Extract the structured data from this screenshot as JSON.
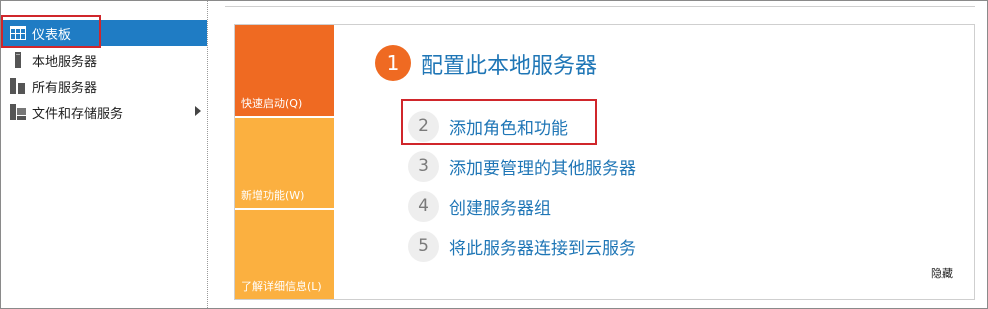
{
  "sidebar": {
    "items": [
      {
        "label": "仪表板",
        "icon": "dashboard-grid-icon",
        "selected": true
      },
      {
        "label": "本地服务器",
        "icon": "server-icon"
      },
      {
        "label": "所有服务器",
        "icon": "servers-icon"
      },
      {
        "label": "文件和存储服务",
        "icon": "file-storage-icon",
        "has_submenu": true
      }
    ]
  },
  "quick_tiles": [
    {
      "label": "快速启动(Q)",
      "color": "#ef6a22"
    },
    {
      "label": "新增功能(W)",
      "color": "#fbb040"
    },
    {
      "label": "了解详细信息(L)",
      "color": "#fbb040"
    }
  ],
  "steps": [
    {
      "number": "1",
      "label": "配置此本地服务器"
    },
    {
      "number": "2",
      "label": "添加角色和功能"
    },
    {
      "number": "3",
      "label": "添加要管理的其他服务器"
    },
    {
      "number": "4",
      "label": "创建服务器组"
    },
    {
      "number": "5",
      "label": "将此服务器连接到云服务"
    }
  ],
  "hide_label": "隐藏",
  "colors": {
    "accent": "#1f7cc4",
    "link": "#1f76b6",
    "orange": "#ef6a22",
    "amber": "#fbb040",
    "highlight": "#d0262b"
  }
}
